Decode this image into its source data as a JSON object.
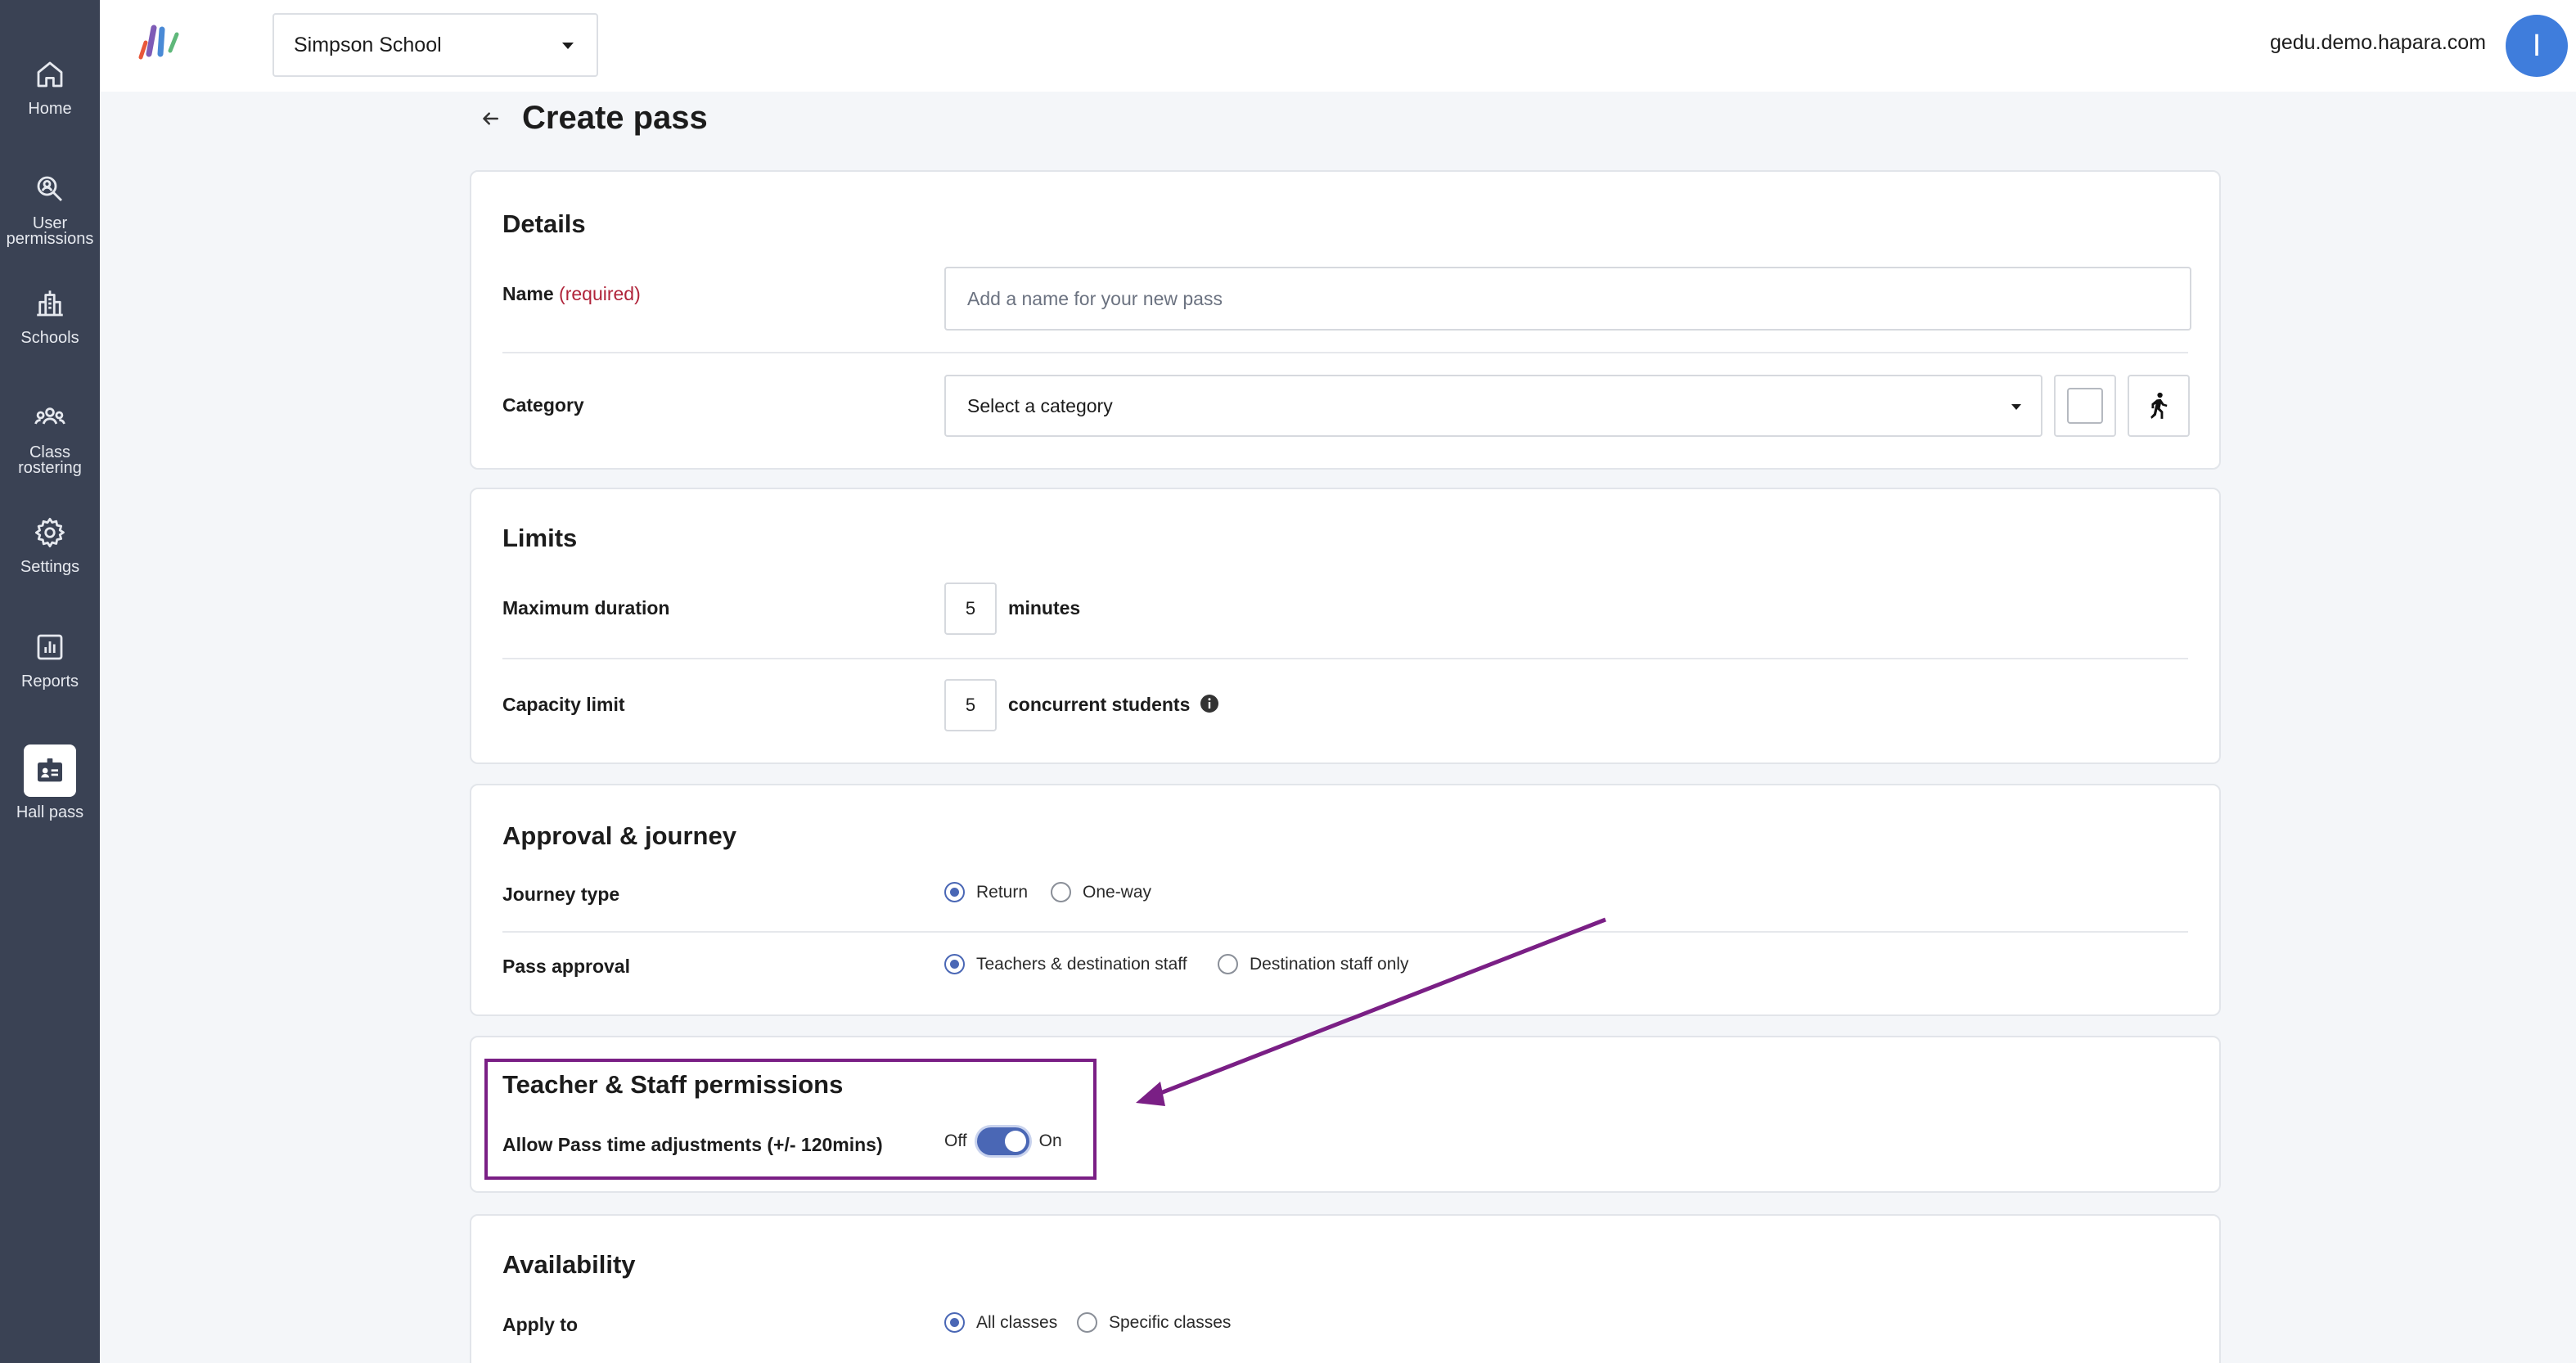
{
  "nav": [
    {
      "label": "Home",
      "icon": "home-icon"
    },
    {
      "label": "User permissions",
      "icon": "user-search-icon"
    },
    {
      "label": "Schools",
      "icon": "schools-icon"
    },
    {
      "label": "Class rostering",
      "icon": "class-rostering-icon"
    },
    {
      "label": "Settings",
      "icon": "gear-icon"
    },
    {
      "label": "Reports",
      "icon": "reports-icon"
    },
    {
      "label": "Hall pass",
      "icon": "hall-pass-icon",
      "active": true
    }
  ],
  "header": {
    "school": "Simpson School",
    "domain": "gedu.demo.hapara.com",
    "avatar_initial": "I"
  },
  "page": {
    "title": "Create pass"
  },
  "details": {
    "title": "Details",
    "name_label": "Name",
    "name_required": "(required)",
    "name_placeholder": "Add a name for your new pass",
    "name_value": "",
    "category_label": "Category",
    "category_value": "Select a category"
  },
  "limits": {
    "title": "Limits",
    "max_duration_label": "Maximum duration",
    "max_duration_value": "5",
    "max_duration_unit": "minutes",
    "capacity_label": "Capacity limit",
    "capacity_value": "5",
    "capacity_unit": "concurrent students"
  },
  "approval": {
    "title": "Approval & journey",
    "journey_label": "Journey type",
    "journey_options": [
      "Return",
      "One-way"
    ],
    "journey_selected": "Return",
    "approval_label": "Pass approval",
    "approval_options": [
      "Teachers & destination staff",
      "Destination staff only"
    ],
    "approval_selected": "Teachers & destination staff"
  },
  "permissions": {
    "title": "Teacher & Staff permissions",
    "adjust_label": "Allow Pass time adjustments (+/- 120mins)",
    "off_label": "Off",
    "on_label": "On",
    "enabled": true
  },
  "availability": {
    "title": "Availability",
    "apply_label": "Apply to",
    "options": [
      "All classes",
      "Specific classes"
    ],
    "selected": "All classes"
  },
  "colors": {
    "sidebar": "#3a4254",
    "accent": "#4a67b5",
    "highlight": "#7a1f85",
    "avatar": "#3f7ddc",
    "required": "#b0243a"
  }
}
